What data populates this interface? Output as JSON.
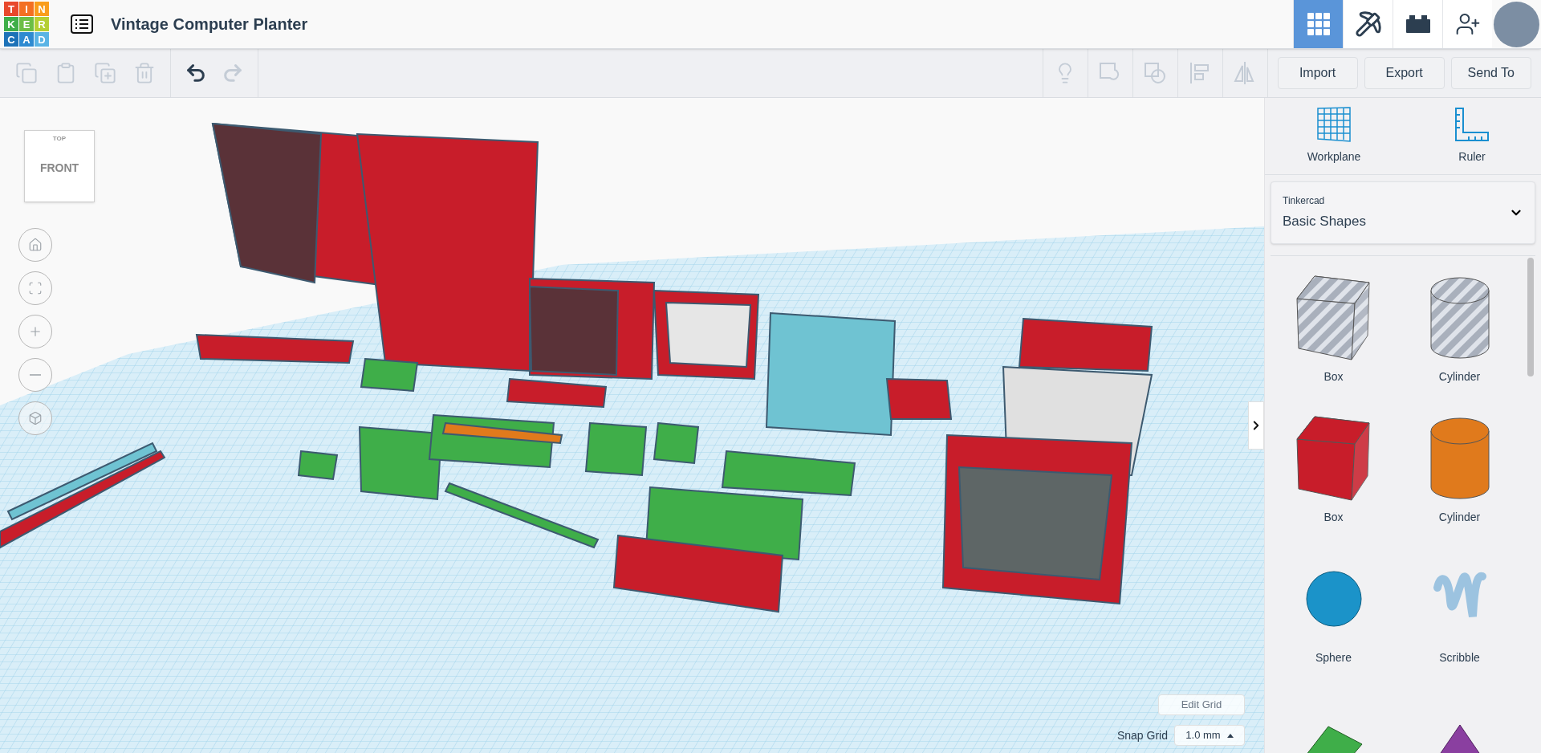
{
  "header": {
    "logo": [
      {
        "letter": "T",
        "color": "#e8482c"
      },
      {
        "letter": "I",
        "color": "#f36f22"
      },
      {
        "letter": "N",
        "color": "#f99d1c"
      },
      {
        "letter": "K",
        "color": "#3fae49"
      },
      {
        "letter": "E",
        "color": "#6cbe45"
      },
      {
        "letter": "R",
        "color": "#b5cf35"
      },
      {
        "letter": "C",
        "color": "#1d72b8"
      },
      {
        "letter": "A",
        "color": "#2d8ad1"
      },
      {
        "letter": "D",
        "color": "#5ab4e5"
      }
    ],
    "title": "Vintage Computer Planter",
    "nav_buttons": [
      {
        "kind": "design",
        "selected": true
      },
      {
        "kind": "bricks",
        "selected": false
      },
      {
        "kind": "blocks",
        "selected": false
      },
      {
        "kind": "invite",
        "selected": false
      }
    ]
  },
  "toolbar": {
    "edit_tools": [
      {
        "kind": "copy",
        "disabled": true
      },
      {
        "kind": "paste",
        "disabled": true
      },
      {
        "kind": "duplicate",
        "disabled": true
      },
      {
        "kind": "delete",
        "disabled": true
      }
    ],
    "history_tools": [
      {
        "kind": "undo",
        "disabled": false
      },
      {
        "kind": "redo",
        "disabled": true
      }
    ],
    "shape_tools": [
      {
        "kind": "notes",
        "disabled": true
      },
      {
        "kind": "group",
        "disabled": true
      },
      {
        "kind": "ungroup",
        "disabled": true
      },
      {
        "kind": "align",
        "disabled": true
      },
      {
        "kind": "mirror",
        "disabled": true
      }
    ],
    "buttons": [
      "Import",
      "Export",
      "Send To"
    ]
  },
  "view_cube": {
    "top": "TOP",
    "front": "FRONT"
  },
  "view_controls": [
    {
      "kind": "home"
    },
    {
      "kind": "fit"
    },
    {
      "kind": "zoom_in"
    },
    {
      "kind": "zoom_out"
    },
    {
      "kind": "perspective"
    }
  ],
  "grid_controls": {
    "edit_button": "Edit Grid",
    "snap_label": "Snap Grid",
    "snap_value": "1.0 mm"
  },
  "panel": {
    "tools": [
      {
        "kind": "workplane",
        "label": "Workplane"
      },
      {
        "kind": "ruler",
        "label": "Ruler"
      }
    ],
    "library": {
      "label": "Tinkercad",
      "value": "Basic Shapes"
    },
    "shapes": [
      {
        "kind": "box",
        "hole": true,
        "color": "#a9b0bc",
        "label": "Box"
      },
      {
        "kind": "cylinder",
        "hole": true,
        "color": "#a9b0bc",
        "label": "Cylinder"
      },
      {
        "kind": "box",
        "hole": false,
        "color": "#c81d2a",
        "label": "Box"
      },
      {
        "kind": "cylinder",
        "hole": false,
        "color": "#e07a1c",
        "label": "Cylinder"
      },
      {
        "kind": "sphere",
        "hole": false,
        "color": "#1b93c9",
        "label": "Sphere"
      },
      {
        "kind": "scribble",
        "hole": false,
        "color": "#9cc3e0",
        "label": "Scribble"
      },
      {
        "kind": "roof",
        "hole": false,
        "color": "#3fae49"
      },
      {
        "kind": "cone",
        "hole": false,
        "color": "#8a3fa0"
      }
    ]
  }
}
